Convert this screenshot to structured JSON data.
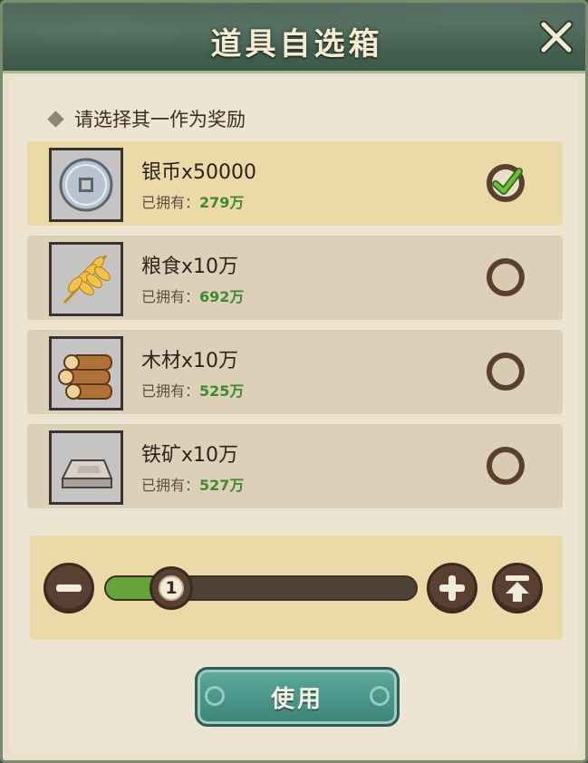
{
  "window": {
    "title": "道具自选箱"
  },
  "prompt": "请选择其一作为奖励",
  "owned_label": "已拥有：",
  "items": [
    {
      "name": "银币x50000",
      "owned": "279万",
      "icon": "silver-coin-icon",
      "selected": true
    },
    {
      "name": "粮食x10万",
      "owned": "692万",
      "icon": "wheat-icon",
      "selected": false
    },
    {
      "name": "木材x10万",
      "owned": "525万",
      "icon": "wood-logs-icon",
      "selected": false
    },
    {
      "name": "铁矿x10万",
      "owned": "527万",
      "icon": "iron-ingot-icon",
      "selected": false
    }
  ],
  "quantity": {
    "value": "1",
    "fill_fraction": 0.22
  },
  "use_button": "使用",
  "colors": {
    "header": "#3d5a4b",
    "selected_row": "#ecd9a8",
    "row": "#ddd0b9",
    "owned_amount": "#3e8a2f",
    "use_button": "#4a968b"
  }
}
